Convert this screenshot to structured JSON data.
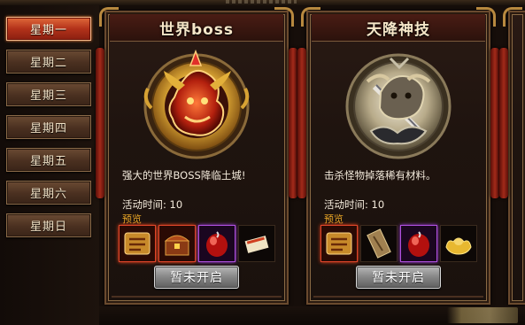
{
  "sidebar": {
    "days": [
      {
        "label": "星期一",
        "active": true
      },
      {
        "label": "星期二",
        "active": false
      },
      {
        "label": "星期三",
        "active": false
      },
      {
        "label": "星期四",
        "active": false
      },
      {
        "label": "星期五",
        "active": false
      },
      {
        "label": "星期六",
        "active": false
      },
      {
        "label": "星期日",
        "active": false
      }
    ]
  },
  "cards": [
    {
      "title": "世界boss",
      "emblem_icon": "golden-dragon-emblem-icon",
      "description": "强大的世界BOSS降临土城!",
      "time_label": "活动时间: 10",
      "preview_label": "预览",
      "items": [
        {
          "icon": "title-card-item-icon",
          "frame": "red"
        },
        {
          "icon": "treasure-chest-item-icon",
          "frame": "red"
        },
        {
          "icon": "red-gem-item-icon",
          "frame": "purple"
        },
        {
          "icon": "scroll-item-icon",
          "frame": "plain"
        }
      ],
      "button_label": "暂未开启"
    },
    {
      "title": "天降神技",
      "emblem_icon": "silver-warrior-emblem-icon",
      "description": "击杀怪物掉落稀有材料。",
      "time_label": "活动时间: 10",
      "preview_label": "预览",
      "items": [
        {
          "icon": "title-card-item-icon",
          "frame": "red"
        },
        {
          "icon": "ancient-scroll-item-icon",
          "frame": "plain"
        },
        {
          "icon": "red-gem-item-icon",
          "frame": "purple"
        },
        {
          "icon": "gold-ingot-item-icon",
          "frame": "plain"
        }
      ],
      "button_label": "暂未开启"
    }
  ],
  "colors": {
    "active_day": "#b3321a",
    "inactive_day": "#4a3020",
    "preview_text": "#e8a526",
    "button_gray": "#8a8a8a"
  }
}
